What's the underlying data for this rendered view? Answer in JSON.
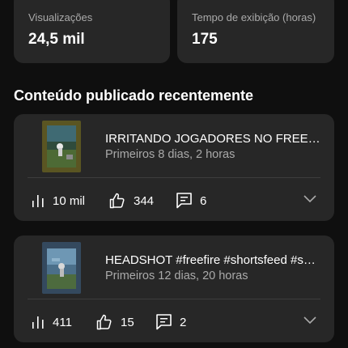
{
  "stats": [
    {
      "label": "Visualizações",
      "value": "24,5 mil"
    },
    {
      "label": "Tempo de exibição (horas)",
      "value": "175"
    }
  ],
  "section_title": "Conteúdo publicado recentemente",
  "videos": [
    {
      "title": "IRRITANDO JOGADORES NO FREEFIRE",
      "meta": "Primeiros 8 dias, 2 horas",
      "views": "10 mil",
      "likes": "344",
      "comments": "6"
    },
    {
      "title": "HEADSHOT #freefire #shortsfeed #shorts",
      "meta": "Primeiros 12 dias, 20 horas",
      "views": "411",
      "likes": "15",
      "comments": "2"
    }
  ],
  "colors": {
    "background": "#0f0f0f",
    "card": "#272727",
    "secondary_text": "#aaaaaa"
  },
  "icons": [
    "views-bars-icon",
    "thumbs-up-icon",
    "comment-icon",
    "chevron-down-icon"
  ]
}
